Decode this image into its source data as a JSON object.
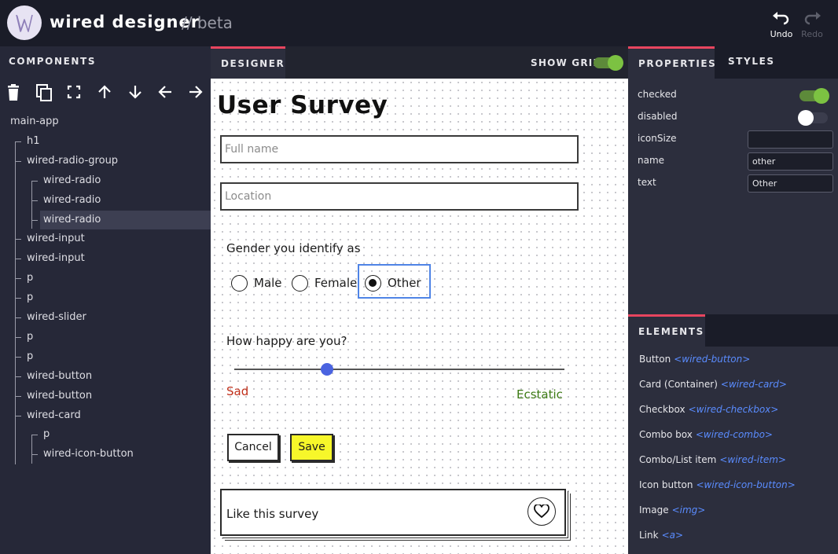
{
  "header": {
    "app_name": "wired designer",
    "app_suffix": "// beta",
    "undo_label": "Undo",
    "redo_label": "Redo"
  },
  "components_panel": {
    "title": "COMPONENTS",
    "tools": [
      "trash-icon",
      "copy-icon",
      "fullscreen-icon",
      "arrow-up-icon",
      "arrow-down-icon",
      "arrow-left-icon",
      "arrow-right-icon"
    ],
    "tree": [
      {
        "label": "main-app",
        "depth": 0
      },
      {
        "label": "h1",
        "depth": 1
      },
      {
        "label": "wired-radio-group",
        "depth": 1
      },
      {
        "label": "wired-radio",
        "depth": 2
      },
      {
        "label": "wired-radio",
        "depth": 2
      },
      {
        "label": "wired-radio",
        "depth": 2,
        "selected": true
      },
      {
        "label": "wired-input",
        "depth": 1
      },
      {
        "label": "wired-input",
        "depth": 1
      },
      {
        "label": "p",
        "depth": 1
      },
      {
        "label": "p",
        "depth": 1
      },
      {
        "label": "wired-slider",
        "depth": 1
      },
      {
        "label": "p",
        "depth": 1
      },
      {
        "label": "p",
        "depth": 1
      },
      {
        "label": "wired-button",
        "depth": 1
      },
      {
        "label": "wired-button",
        "depth": 1
      },
      {
        "label": "wired-card",
        "depth": 1
      },
      {
        "label": "p",
        "depth": 2
      },
      {
        "label": "wired-icon-button",
        "depth": 2
      }
    ]
  },
  "designer": {
    "tab_label": "DESIGNER",
    "grid_label": "SHOW GRID",
    "show_grid": true,
    "survey": {
      "title": "User Survey",
      "name_placeholder": "Full name",
      "location_placeholder": "Location",
      "gender_prompt": "Gender you identify as",
      "gender_options": [
        "Male",
        "Female",
        "Other"
      ],
      "gender_selected": "Other",
      "happy_prompt": "How happy are you?",
      "slider_value": 0.28,
      "slider_min_label": "Sad",
      "slider_max_label": "Ecstatic",
      "cancel_label": "Cancel",
      "save_label": "Save",
      "card_text": "Like this survey"
    }
  },
  "properties_panel": {
    "tab_properties": "PROPERTIES",
    "tab_styles": "STYLES",
    "props": {
      "checked_label": "checked",
      "checked": true,
      "disabled_label": "disabled",
      "disabled": false,
      "iconsize_label": "iconSize",
      "iconsize_value": "",
      "name_label": "name",
      "name_value": "other",
      "text_label": "text",
      "text_value": "Other"
    }
  },
  "elements_panel": {
    "title": "ELEMENTS",
    "items": [
      {
        "label": "Button",
        "tag": "<wired-button>"
      },
      {
        "label": "Card (Container)",
        "tag": "<wired-card>"
      },
      {
        "label": "Checkbox",
        "tag": "<wired-checkbox>"
      },
      {
        "label": "Combo box",
        "tag": "<wired-combo>"
      },
      {
        "label": "Combo/List item",
        "tag": "<wired-item>"
      },
      {
        "label": "Icon button",
        "tag": "<wired-icon-button>"
      },
      {
        "label": "Image",
        "tag": "<img>"
      },
      {
        "label": "Link",
        "tag": "<a>"
      }
    ]
  },
  "colors": {
    "accent": "#e8455f",
    "toggle_on": "#7cc242",
    "selection_blue": "#4f84e6",
    "slider_knob": "#4a63e0",
    "save_button": "#f7f72a",
    "sad_text": "#c0301b",
    "ecstatic_text": "#3c7a14",
    "tag_text": "#5a8cff"
  }
}
